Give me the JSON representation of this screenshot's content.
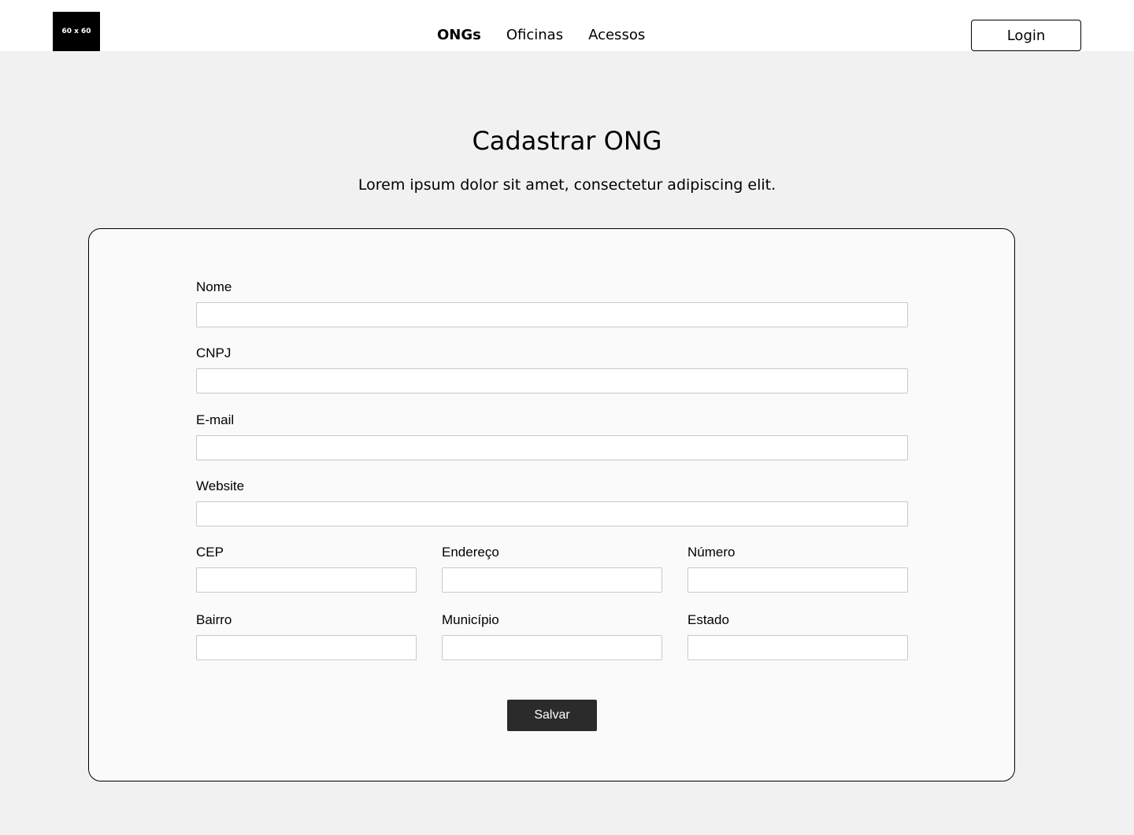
{
  "header": {
    "logo_text": "60 x 60",
    "nav": [
      {
        "label": "ONGs",
        "active": true
      },
      {
        "label": "Oficinas",
        "active": false
      },
      {
        "label": "Acessos",
        "active": false
      }
    ],
    "login_label": "Login"
  },
  "main": {
    "title": "Cadastrar ONG",
    "subtitle": "Lorem ipsum dolor sit amet, consectetur adipiscing elit."
  },
  "form": {
    "nome_label": "Nome",
    "nome_value": "",
    "cnpj_label": "CNPJ",
    "cnpj_value": "",
    "email_label": "E-mail",
    "email_value": "",
    "website_label": "Website",
    "website_value": "",
    "cep_label": "CEP",
    "cep_value": "",
    "endereco_label": "Endereço",
    "endereco_value": "",
    "numero_label": "Número",
    "numero_value": "",
    "bairro_label": "Bairro",
    "bairro_value": "",
    "municipio_label": "Município",
    "municipio_value": "",
    "estado_label": "Estado",
    "estado_value": "",
    "save_label": "Salvar"
  },
  "colors": {
    "page_bg": "#f1f1f1",
    "card_bg": "#fafafa",
    "button_bg": "#2b2b2b"
  }
}
